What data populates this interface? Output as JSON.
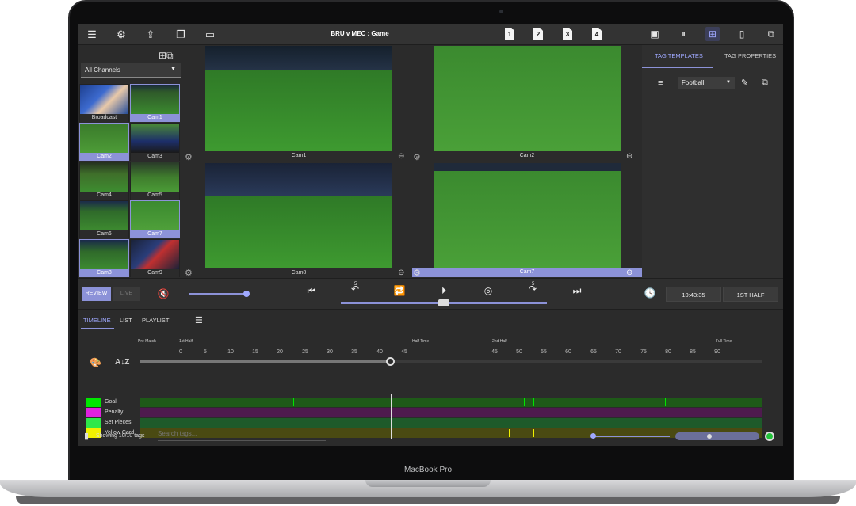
{
  "device": {
    "brand_label": "MacBook Pro"
  },
  "topbar": {
    "title": "BRU v MEC : Game",
    "pages": [
      "1",
      "2",
      "3",
      "4"
    ],
    "left_icons": [
      "menu-icon",
      "gear-icon",
      "share-icon",
      "bookmark-icon",
      "window-icon"
    ],
    "right_icons": [
      "stop-icon",
      "pause-icon",
      "grid-icon",
      "tablet-icon",
      "external-link-icon"
    ]
  },
  "channels": {
    "selected": "All Channels",
    "thumbnails": [
      {
        "label": "Broadcast",
        "selected": false
      },
      {
        "label": "Cam1",
        "selected": true
      },
      {
        "label": "Cam2",
        "selected": true
      },
      {
        "label": "Cam3",
        "selected": false
      },
      {
        "label": "Cam4",
        "selected": false
      },
      {
        "label": "Cam5",
        "selected": false
      },
      {
        "label": "Cam6",
        "selected": false
      },
      {
        "label": "Cam7",
        "selected": true
      },
      {
        "label": "Cam8",
        "selected": true
      },
      {
        "label": "Cam9",
        "selected": false
      }
    ]
  },
  "videos": {
    "v1": "Cam1",
    "v2": "Cam2",
    "v3": "Cam8",
    "v4": "Cam7"
  },
  "right_panel": {
    "tab_templates": "TAG TEMPLATES",
    "tab_properties": "TAG PROPERTIES",
    "template": "Football"
  },
  "controls": {
    "review": "REVIEW",
    "live": "LIVE",
    "skip_back": "5",
    "skip_fwd": "5",
    "clock": "10:43:35",
    "period": "1ST HALF",
    "volume_level": 1.0,
    "seek_position": 0.5
  },
  "timeline": {
    "tabs": [
      "TIMELINE",
      "LIST",
      "PLAYLIST"
    ],
    "phases": [
      "Pre Match",
      "1st Half",
      "Half Time",
      "2nd Half",
      "Full Time"
    ],
    "minutes_first": [
      "0",
      "5",
      "10",
      "15",
      "20",
      "25",
      "30",
      "35",
      "40",
      "45"
    ],
    "minutes_second": [
      "45",
      "50",
      "55",
      "60",
      "65",
      "70",
      "75",
      "80",
      "85",
      "90"
    ],
    "tags": [
      {
        "name": "Goal",
        "color": "#00e600"
      },
      {
        "name": "Penalty",
        "color": "#e020e0"
      },
      {
        "name": "Set Pieces",
        "color": "#2ee84a"
      },
      {
        "name": "Yellow Card",
        "color": "#f0f000"
      }
    ],
    "showing": "Showing 10/10 tags",
    "search_placeholder": "Search tags..."
  }
}
